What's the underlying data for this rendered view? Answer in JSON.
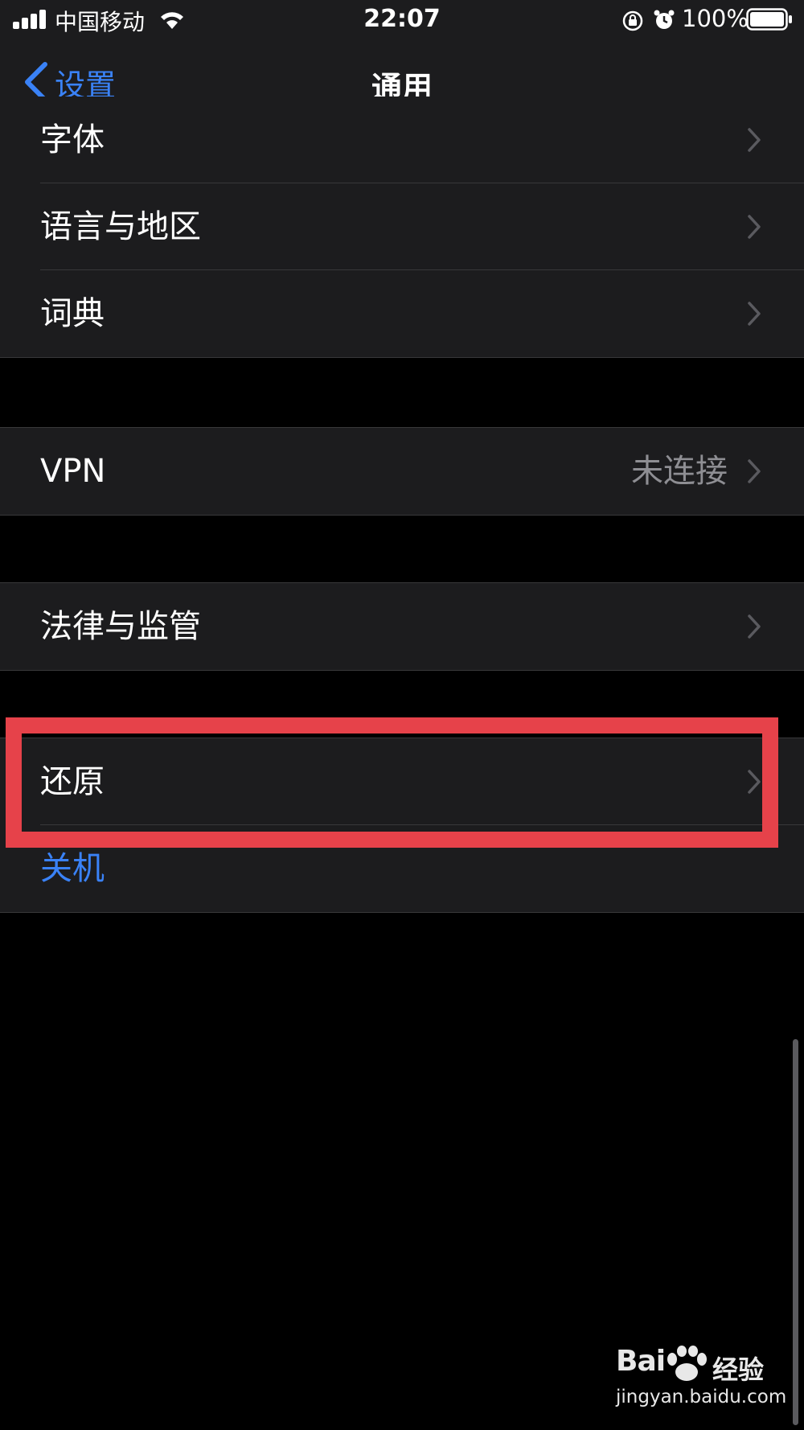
{
  "status_bar": {
    "carrier": "中国移动",
    "time": "22:07",
    "battery_percent": "100%"
  },
  "nav": {
    "back_label": "设置",
    "title": "通用"
  },
  "group1": {
    "items": [
      {
        "label": "字体"
      },
      {
        "label": "语言与地区"
      },
      {
        "label": "词典"
      }
    ]
  },
  "group_vpn": {
    "label": "VPN",
    "value": "未连接"
  },
  "group_legal": {
    "label": "法律与监管"
  },
  "group_reset": {
    "items": [
      {
        "label": "还原"
      },
      {
        "label": "关机"
      }
    ]
  },
  "highlight": {
    "color": "#e6424a",
    "target": "还原"
  },
  "colors": {
    "accent": "#3a82f7",
    "background": "#000000",
    "cell": "#1c1c1e",
    "secondary_text": "#8e8e93"
  },
  "watermark": {
    "brand_left": "Bai",
    "brand_right": "经验",
    "url": "jingyan.baidu.com"
  }
}
